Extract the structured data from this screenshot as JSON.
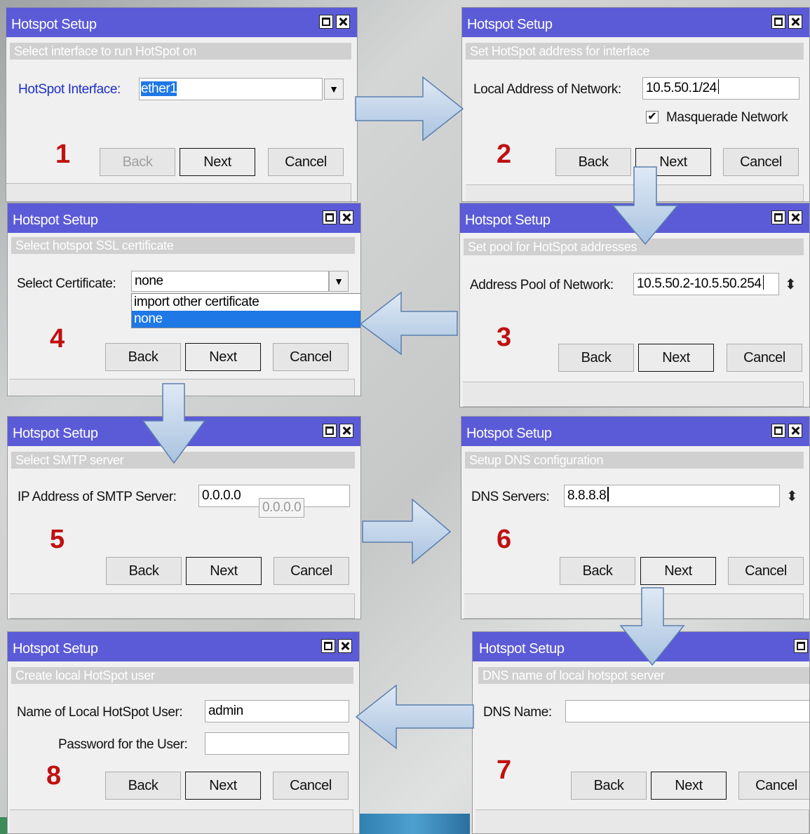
{
  "common": {
    "window_title": "Hotspot Setup",
    "back_label": "Back",
    "next_label": "Next",
    "cancel_label": "Cancel"
  },
  "step1": {
    "number": "1",
    "banner": "Select interface to run HotSpot on",
    "label": "HotSpot Interface:",
    "value": "ether1"
  },
  "step2": {
    "number": "2",
    "banner": "Set HotSpot address for interface",
    "label": "Local Address of Network:",
    "value": "10.5.50.1/24",
    "checkbox_label": "Masquerade Network",
    "checkbox_checked": true
  },
  "step3": {
    "number": "3",
    "banner": "Set pool for HotSpot addresses",
    "label": "Address Pool of Network:",
    "value": "10.5.50.2-10.5.50.254"
  },
  "step4": {
    "number": "4",
    "banner": "Select hotspot SSL certificate",
    "label": "Select Certificate:",
    "value": "none",
    "options": [
      "import other certificate",
      "none"
    ]
  },
  "step5": {
    "number": "5",
    "banner": "Select SMTP server",
    "label": "IP Address of SMTP Server:",
    "value": "0.0.0.0",
    "tooltip": "0.0.0.0"
  },
  "step6": {
    "number": "6",
    "banner": "Setup DNS configuration",
    "label": "DNS Servers:",
    "value": "8.8.8.8"
  },
  "step7": {
    "number": "7",
    "banner": "DNS name of local hotspot server",
    "label": "DNS Name:",
    "value": ""
  },
  "step8": {
    "number": "8",
    "banner": "Create local HotSpot user",
    "user_label": "Name of Local HotSpot User:",
    "user_value": "admin",
    "password_label": "Password for the User:",
    "password_value": ""
  },
  "colors": {
    "titlebar": "#5b5bd8",
    "step_number": "#c01010",
    "arrow_fill": "#b8cfe6",
    "selection": "#1e78e6"
  }
}
